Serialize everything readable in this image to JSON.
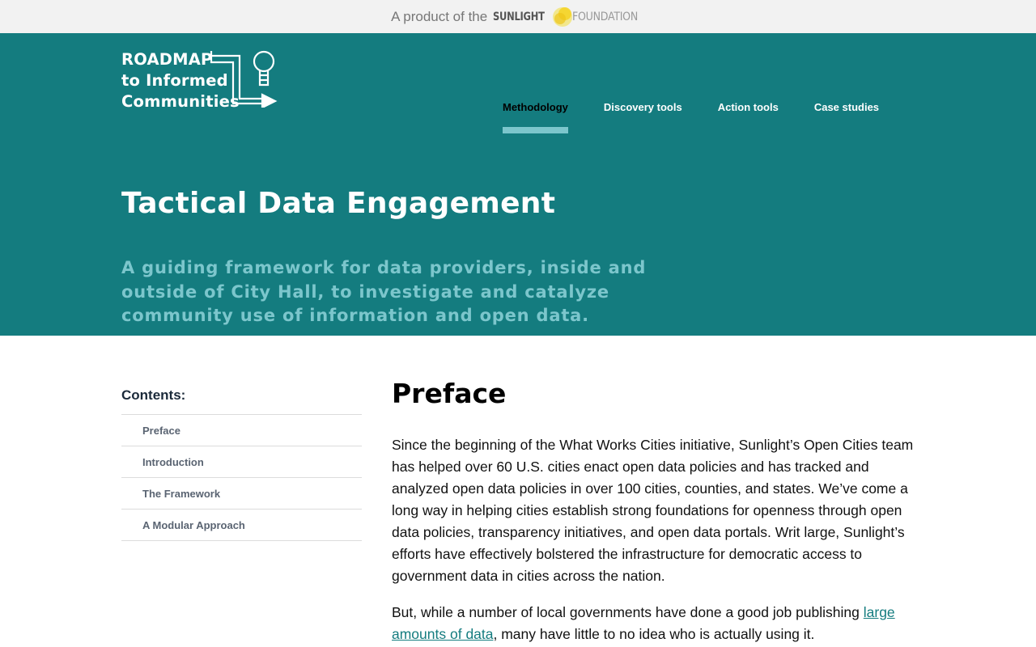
{
  "topbar": {
    "prefix": "A product of the",
    "org_name_a": "SUNLIGHT",
    "org_name_b": "FOUNDATION"
  },
  "header": {
    "logo_lines": [
      "ROADMAP",
      "to Informed",
      "Communities"
    ],
    "nav": [
      {
        "label": "Methodology",
        "active": true
      },
      {
        "label": "Discovery tools",
        "active": false
      },
      {
        "label": "Action tools",
        "active": false
      },
      {
        "label": "Case studies",
        "active": false
      }
    ],
    "title": "Tactical Data Engagement",
    "subtitle": "A guiding framework for data providers, inside and outside of City Hall, to investigate and catalyze community use of information and open data."
  },
  "toc": {
    "title": "Contents:",
    "items": [
      "Preface",
      "Introduction",
      "The Framework",
      "A Modular Approach"
    ]
  },
  "content": {
    "heading": "Preface",
    "para1": "Since the beginning of the What Works Cities initiative, Sunlight’s Open Cities team has helped over 60 U.S. cities enact open data policies and has tracked and analyzed open data policies in over 100 cities, counties, and states. We’ve come a long way in helping cities establish strong foundations for openness through open data policies, transparency initiatives, and open data portals. Writ large, Sunlight’s efforts have effectively bolstered the infrastructure for democratic access to government data in cities across the nation.",
    "para2_before": "But, while a number of local governments have done a good job publishing ",
    "para2_link": "large amounts of data",
    "para2_after": ", many have little to no idea who is actually using it."
  },
  "colors": {
    "brand_teal": "#147c7f",
    "accent_light_teal": "#7cc6cc",
    "topbar_bg": "#f2f2f2"
  },
  "icons": {
    "logo_graphic": "lightbulb-arrow-icon",
    "sunlight_mark": "sun-icon"
  }
}
